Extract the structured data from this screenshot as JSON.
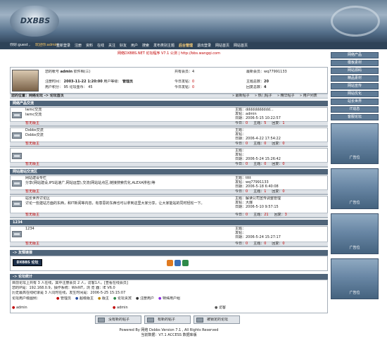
{
  "header": {
    "logo_text": "DXBBS",
    "nav_left": "你好:guest ,",
    "nav_user": "欢迎你:admin",
    "nav_links": [
      "重新登录",
      "注册",
      "资料",
      "在线",
      "关注",
      "好友",
      "用户",
      "搜索",
      "发布类别主题",
      "后台管理",
      "退出登录",
      "网站首页",
      "网站首页"
    ]
  },
  "banner": {
    "title": "网络DXBBS.NET 论坛程序 V7.1 公测",
    "url": "http://bbs.wangqi.com"
  },
  "user_panel": {
    "username_label": "您的帐号",
    "username": "admin",
    "group": "钦件释(三)",
    "register_label": "注册时间：",
    "register_time": "2003-11-22 1:20:00",
    "group_label": "用户等级：",
    "group_value": "管理员",
    "points_label": "用户积分：",
    "points": "95",
    "forum_level": "论坛金币：",
    "forum_level_value": "45",
    "total_members": "共有会员：4",
    "newest_member": "最新会员：wq77991133",
    "today_posts": "今日发帖：",
    "today_posts_val": "0",
    "total_topics": "主题总数：",
    "total_topics_val": "20",
    "yesterday_posts": "今日发帖：",
    "yesterday_val": "0",
    "total_replies": "回复总数：",
    "total_replies_val": "4"
  },
  "breadcrumb": {
    "location": "您的位置：网络论坛 -> 论坛首页",
    "links": [
      "最新帖子",
      "热门帖子",
      "精华帖子",
      "用户列表"
    ]
  },
  "sidebar": {
    "buttons": [
      "网络产品",
      "模板素材",
      "网站源码",
      "精品素材",
      "网站宣传",
      "网站优化",
      "站长世界",
      "IT动态",
      "客服论坛"
    ],
    "ad_label": "广告位"
  },
  "categories": [
    {
      "title": "网络产品交流",
      "forums": [
        {
          "name": "lwmc交流",
          "desc": "lwmc交流",
          "moderator_label": "暂无版主",
          "topic_title": "主题：ddddddddddd...",
          "poster": "发帖：admin",
          "date": "日期：2006-5-15 10:22:57",
          "today": "今日：",
          "today_val": "0",
          "topics": "主题：",
          "topics_val": "5",
          "replies": "回复：",
          "replies_val": "1"
        },
        {
          "name": "Dxbbs交流",
          "desc": "Dxbbs交流",
          "moderator_label": "暂无版主",
          "topic_title": "主题：",
          "poster": "发帖：",
          "date": "日期：2006-4-22 17:54:22",
          "today": "今日：",
          "today_val": "0",
          "topics": "主题：",
          "topics_val": "0",
          "replies": "回复：",
          "replies_val": "0"
        },
        {
          "name": "",
          "desc": "",
          "moderator_label": "暂无版主",
          "topic_title": "主题：",
          "poster": "发帖：",
          "date": "日期：2006-5-24 15:26:42",
          "today": "今日：",
          "today_val": "0",
          "topics": "主题：",
          "topics_val": "0",
          "replies": "回复：",
          "replies_val": "0"
        }
      ]
    },
    {
      "title": "网站建站交流区",
      "forums": [
        {
          "name": "网站建设专栏",
          "desc": "分享(网站建设,IPS站速广,网站运营),交流(网站站点区,链接搜索优化,ALEXA排名)等",
          "moderator_label": "暂无版主",
          "topic_title": "主题：tttt",
          "poster": "发帖：wq77991133",
          "date": "日期：2006-5-18 6:40:08",
          "today": "今日：",
          "today_val": "0",
          "topics": "主题：",
          "topics_val": "1",
          "replies": "回复：",
          "replies_val": "0"
        },
        {
          "name": "站长世界讨论区",
          "desc": "讨论一些建站方面的东西，和IT新闻等内容，有意思的东西也可以拿到这里大家分享，让大家能站的同时轻松一下。",
          "moderator_label": "暂无版主",
          "topic_title": "主题：解读公司宣传调整管理",
          "poster": "发帖：大爆",
          "date": "日期：2006-5-10 9:57:15",
          "today": "今日：",
          "today_val": "0",
          "topics": "主题：",
          "topics_val": "21",
          "replies": "回复：",
          "replies_val": "3"
        }
      ]
    },
    {
      "title": "1234",
      "forums": [
        {
          "name": "1234",
          "desc": "",
          "moderator_label": "暂无版主",
          "topic_title": "主题：",
          "poster": "发帖：",
          "date": "日期：2006-5-24 15:27:17",
          "today": "今日：",
          "today_val": "0",
          "topics": "主题：",
          "topics_val": "0",
          "replies": "回复：",
          "replies_val": "0"
        }
      ]
    }
  ],
  "friend_links": {
    "title": "友情链接",
    "logo": "DXBBS 论坛"
  },
  "stats": {
    "title": "论坛统计",
    "line1": "目前论坛上共有 3 人在线，其中注册会员 2 人，访客1人。[查看在线会员]",
    "line2": "您的IP是：192.168.0.9，操作系统：WinNT，浏 览 器：IE V6.0",
    "line3": "历史最高在线纪录是 3 人同时在线，发生时间是：2006-5-25 15:15:07",
    "legend": "论坛用户级图例：",
    "legend_items": [
      "管理员",
      "超级版主",
      "版主",
      "论坛贵宾",
      "注册用户",
      "特殊用户组"
    ],
    "online_users": [
      "admin",
      "admin",
      "访客"
    ]
  },
  "footer_buttons": [
    "没有新的帖子",
    "有新的帖子",
    "被锁定的论坛"
  ],
  "footer": {
    "powered": "Powered By 网络 Dxbbs Version 7.1 , All Rights Reserved",
    "version": "当前数据：V7.1 ACCESS 数据库版"
  },
  "colors": {
    "header_dark": "#3a5068",
    "accent_red": "#c00000",
    "bar_bg": "#dfe3e8"
  }
}
